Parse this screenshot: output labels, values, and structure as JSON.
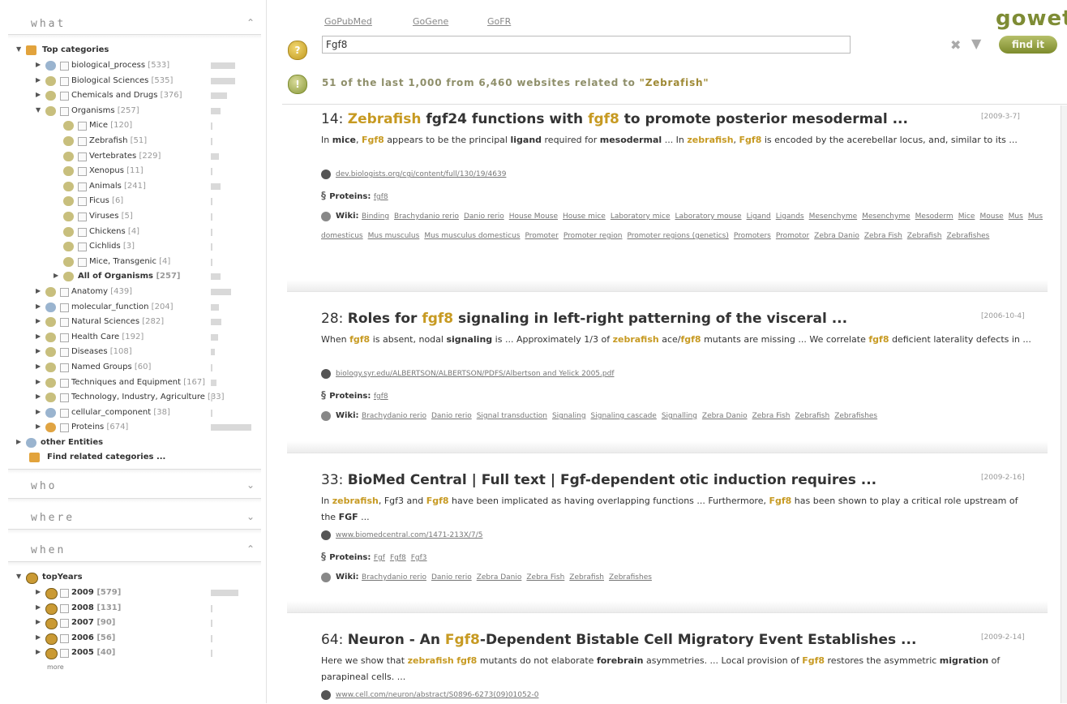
{
  "sections": {
    "what": "what",
    "who": "who",
    "where": "where",
    "when": "when"
  },
  "what_tree": {
    "root": "Top categories",
    "items": [
      {
        "label": "biological_process",
        "count": "[533]",
        "bar": 0.3
      },
      {
        "label": "Biological Sciences",
        "count": "[535]",
        "bar": 0.3
      },
      {
        "label": "Chemicals and Drugs",
        "count": "[376]",
        "bar": 0.2
      },
      {
        "label": "Organisms",
        "count": "[257]",
        "bar": 0.12
      },
      {
        "label": "Mice",
        "count": "[120]",
        "bar": 0.04
      },
      {
        "label": "Zebrafish",
        "count": "[51]",
        "bar": 0.02
      },
      {
        "label": "Vertebrates",
        "count": "[229]",
        "bar": 0.1
      },
      {
        "label": "Xenopus",
        "count": "[11]",
        "bar": 0.01
      },
      {
        "label": "Animals",
        "count": "[241]",
        "bar": 0.12
      },
      {
        "label": "Ficus",
        "count": "[6]",
        "bar": 0.01
      },
      {
        "label": "Viruses",
        "count": "[5]",
        "bar": 0.01
      },
      {
        "label": "Chickens",
        "count": "[4]",
        "bar": 0.01
      },
      {
        "label": "Cichlids",
        "count": "[3]",
        "bar": 0.01
      },
      {
        "label": "Mice, Transgenic",
        "count": "[4]",
        "bar": 0.01
      },
      {
        "label": "All of Organisms",
        "count": "[257]",
        "bar": 0.12
      },
      {
        "label": "Anatomy",
        "count": "[439]",
        "bar": 0.25
      },
      {
        "label": "molecular_function",
        "count": "[204]",
        "bar": 0.1
      },
      {
        "label": "Natural Sciences",
        "count": "[282]",
        "bar": 0.13
      },
      {
        "label": "Health Care",
        "count": "[192]",
        "bar": 0.09
      },
      {
        "label": "Diseases",
        "count": "[108]",
        "bar": 0.05
      },
      {
        "label": "Named Groups",
        "count": "[60]",
        "bar": 0.03
      },
      {
        "label": "Techniques and Equipment",
        "count": "[167]",
        "bar": 0.07
      },
      {
        "label": "Technology, Industry, Agriculture",
        "count": "[33]",
        "bar": 0.02
      },
      {
        "label": "cellular_component",
        "count": "[38]",
        "bar": 0.02
      },
      {
        "label": "Proteins",
        "count": "[674]",
        "bar": 0.5
      }
    ],
    "other": "other Entities",
    "find_related": "Find related categories ..."
  },
  "when_tree": {
    "root": "topYears",
    "items": [
      {
        "label": "2009",
        "count": "[579]",
        "bar": 0.34
      },
      {
        "label": "2008",
        "count": "[131]",
        "bar": 0.04
      },
      {
        "label": "2007",
        "count": "[90]",
        "bar": 0.02
      },
      {
        "label": "2006",
        "count": "[56]",
        "bar": 0.01
      },
      {
        "label": "2005",
        "count": "[40]",
        "bar": 0.01
      }
    ],
    "more": "more"
  },
  "nav": {
    "gopubmed": "GoPubMed",
    "gogene": "GoGene",
    "gofr": "GoFR"
  },
  "search": {
    "value": "Fgf8"
  },
  "logo": "gowet",
  "find_button": "find it",
  "summary": {
    "prefix": "51 of the last 1,000 from 6,460 websites related to ",
    "term": "\"Zebrafish\""
  },
  "results": [
    {
      "num": "14: ",
      "title_parts": [
        [
          "Zebrafish",
          true
        ],
        [
          " fgf24 functions with ",
          false
        ],
        [
          "fgf8",
          true
        ],
        [
          " to promote posterior mesodermal ...",
          false
        ]
      ],
      "date": "[2009-3-7]",
      "snippet": [
        [
          "In ",
          0
        ],
        [
          "mice",
          2
        ],
        [
          ", ",
          0
        ],
        [
          "Fgf8",
          1
        ],
        [
          " appears to be the principal ",
          0
        ],
        [
          "ligand",
          2
        ],
        [
          " required for ",
          0
        ],
        [
          "mesodermal",
          2
        ],
        [
          " ... In ",
          0
        ],
        [
          "zebrafish",
          1
        ],
        [
          ", ",
          0
        ],
        [
          "Fgf8",
          1
        ],
        [
          " is encoded by the acerebellar locus, and, similar to its ...",
          0
        ]
      ],
      "url": "dev.biologists.org/cgi/content/full/130/19/4639",
      "proteins_label": "Proteins:",
      "proteins": [
        "fgf8"
      ],
      "wiki_label": "Wiki:",
      "wiki": [
        "Binding",
        "Brachydanio rerio",
        "Danio rerio",
        "House Mouse",
        "House mice",
        "Laboratory mice",
        "Laboratory mouse",
        "Ligand",
        "Ligands",
        "Mesenchyme",
        "Mesenchyme",
        "Mesoderm",
        "Mice",
        "Mouse",
        "Mus",
        "Mus domesticus",
        "Mus musculus",
        "Mus musculus domesticus",
        "Promoter",
        "Promoter region",
        "Promoter regions (genetics)",
        "Promoters",
        "Promotor",
        "Zebra Danio",
        "Zebra Fish",
        "Zebrafish",
        "Zebrafishes"
      ]
    },
    {
      "num": "28: ",
      "title_parts": [
        [
          "Roles for ",
          false
        ],
        [
          "fgf8",
          true
        ],
        [
          " signaling in left-right patterning of the visceral ...",
          false
        ]
      ],
      "date": "[2006-10-4]",
      "snippet": [
        [
          "When ",
          0
        ],
        [
          "fgf8",
          1
        ],
        [
          " is absent, nodal ",
          0
        ],
        [
          "signaling",
          2
        ],
        [
          " is ... Approximately 1/3 of ",
          0
        ],
        [
          "zebrafish",
          1
        ],
        [
          " ace/",
          0
        ],
        [
          "fgf8",
          1
        ],
        [
          " mutants are missing ... We correlate ",
          0
        ],
        [
          "fgf8",
          1
        ],
        [
          " deficient laterality defects in ...",
          0
        ]
      ],
      "url": "biology.syr.edu/ALBERTSON/ALBERTSON/PDFS/Albertson and Yelick 2005.pdf",
      "proteins_label": "Proteins:",
      "proteins": [
        "fgf8"
      ],
      "wiki_label": "Wiki:",
      "wiki": [
        "Brachydanio rerio",
        "Danio rerio",
        "Signal transduction",
        "Signaling",
        "Signaling cascade",
        "Signalling",
        "Zebra Danio",
        "Zebra Fish",
        "Zebrafish",
        "Zebrafishes"
      ]
    },
    {
      "num": "33: ",
      "title_parts": [
        [
          "BioMed Central | Full text | Fgf-dependent otic induction requires ...",
          false
        ]
      ],
      "date": "[2009-2-16]",
      "snippet": [
        [
          "In ",
          0
        ],
        [
          "zebrafish",
          1
        ],
        [
          ", Fgf3 and ",
          0
        ],
        [
          "Fgf8",
          1
        ],
        [
          " have been implicated as having overlapping functions ... Furthermore, ",
          0
        ],
        [
          "Fgf8",
          1
        ],
        [
          " has been shown to play a critical role upstream of the ",
          0
        ],
        [
          "FGF",
          2
        ],
        [
          " ...",
          0
        ]
      ],
      "url": "www.biomedcentral.com/1471-213X/7/5",
      "proteins_label": "Proteins:",
      "proteins": [
        "Fgf",
        "Fgf8",
        "Fgf3"
      ],
      "wiki_label": "Wiki:",
      "wiki": [
        "Brachydanio rerio",
        "Danio rerio",
        "Zebra Danio",
        "Zebra Fish",
        "Zebrafish",
        "Zebrafishes"
      ]
    },
    {
      "num": "64: ",
      "title_parts": [
        [
          "Neuron - An ",
          false
        ],
        [
          "Fgf8",
          true
        ],
        [
          "-Dependent Bistable Cell Migratory Event Establishes ...",
          false
        ]
      ],
      "date": "[2009-2-14]",
      "snippet": [
        [
          "Here we show that ",
          0
        ],
        [
          "zebrafish",
          1
        ],
        [
          " ",
          0
        ],
        [
          "fgf8",
          1
        ],
        [
          " mutants do not elaborate ",
          0
        ],
        [
          "forebrain",
          2
        ],
        [
          " asymmetries. ... Local provision of ",
          0
        ],
        [
          "Fgf8",
          1
        ],
        [
          " restores the asymmetric ",
          0
        ],
        [
          "migration",
          2
        ],
        [
          " of parapineal cells. ...",
          0
        ]
      ],
      "url": "www.cell.com/neuron/abstract/S0896-6273(09)01052-0",
      "proteins_label": "Proteins:",
      "proteins": [],
      "wiki_label": "Wiki:",
      "wiki": []
    }
  ],
  "colors": {
    "accent": "#c79a22",
    "brand": "#7e8c35"
  }
}
